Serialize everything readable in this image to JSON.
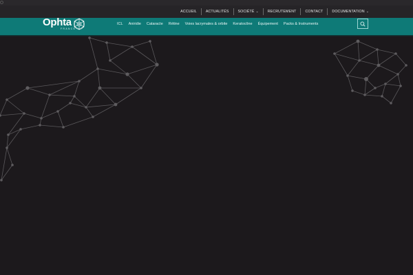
{
  "brand": {
    "name": "Ophta",
    "tagline": "FRANCE"
  },
  "top_nav": [
    {
      "label": "ACCUEIL",
      "has_dropdown": false
    },
    {
      "label": "ACTUALITÉS",
      "has_dropdown": false
    },
    {
      "label": "SOCIÉTÉ",
      "has_dropdown": true
    },
    {
      "label": "RECRUTEMENT",
      "has_dropdown": false
    },
    {
      "label": "CONTACT",
      "has_dropdown": false
    },
    {
      "label": "DOCUMENTATION",
      "has_dropdown": true
    }
  ],
  "main_nav": [
    {
      "label": "ICL"
    },
    {
      "label": "Aniridie"
    },
    {
      "label": "Cataracte"
    },
    {
      "label": "Rétine"
    },
    {
      "label": "Voies lacrymales & orbite"
    },
    {
      "label": "Keratocône"
    },
    {
      "label": "Équipement"
    },
    {
      "label": "Packs & Instruments"
    }
  ],
  "icons": {
    "search": "search-icon",
    "dropdown": "chevron-down-icon",
    "logo": "molecule-logo-icon"
  },
  "colors": {
    "page_background": "#1c191c",
    "top_bar": "#262427",
    "main_bar": "#0e7a77",
    "network_lines": "#5a585b"
  }
}
